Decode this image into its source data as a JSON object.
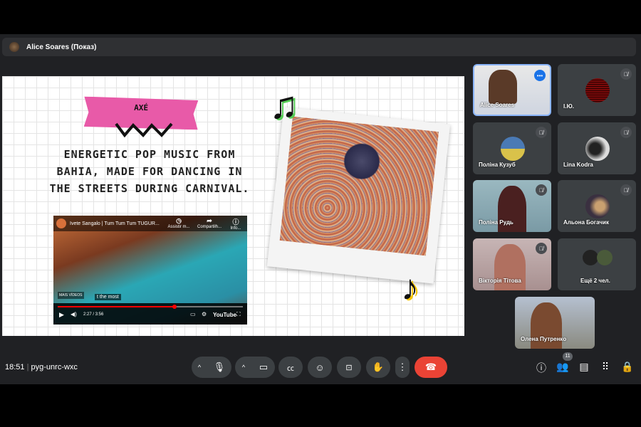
{
  "presenter": {
    "label": "Alice Soares (Показ)"
  },
  "slide": {
    "tag": "AXÉ",
    "headline": "ENERGETIC POP MUSIC FROM BAHIA, MADE FOR DANCING IN THE STREETS DURING CARNIVAL.",
    "video": {
      "title": "Ivete Sangalo | Tum Tum Tum TUGUR...",
      "actions": [
        "Assistir m...",
        "Compartilh...",
        "Info..."
      ],
      "more_videos": "MAIS VÍDEOS",
      "caption": "t the most",
      "time": "2:27 / 3:56",
      "brand": "YouTube",
      "progress": 0.62
    }
  },
  "participants": [
    {
      "name": "Alice Soares",
      "video": true
    },
    {
      "name": "І.Ю.",
      "muted": true
    },
    {
      "name": "Поліна Кузуб",
      "muted": true
    },
    {
      "name": "Lina Kodra",
      "muted": true
    },
    {
      "name": "Поліна Рудь",
      "muted": true,
      "video": true
    },
    {
      "name": "Альона Богачик",
      "muted": true
    },
    {
      "name": "Вікторія Тітова",
      "muted": true,
      "video": true
    },
    {
      "name": "Ещё 2 чел."
    },
    {
      "name": "Олена Путренко",
      "video": true
    }
  ],
  "bottom": {
    "time": "18:51",
    "meeting_code": "pyg-unrc-wxc",
    "participant_count": "11"
  },
  "colors": {
    "accent": "#1a73e8",
    "end_call": "#ea4335",
    "tape": "#e85aa8"
  }
}
